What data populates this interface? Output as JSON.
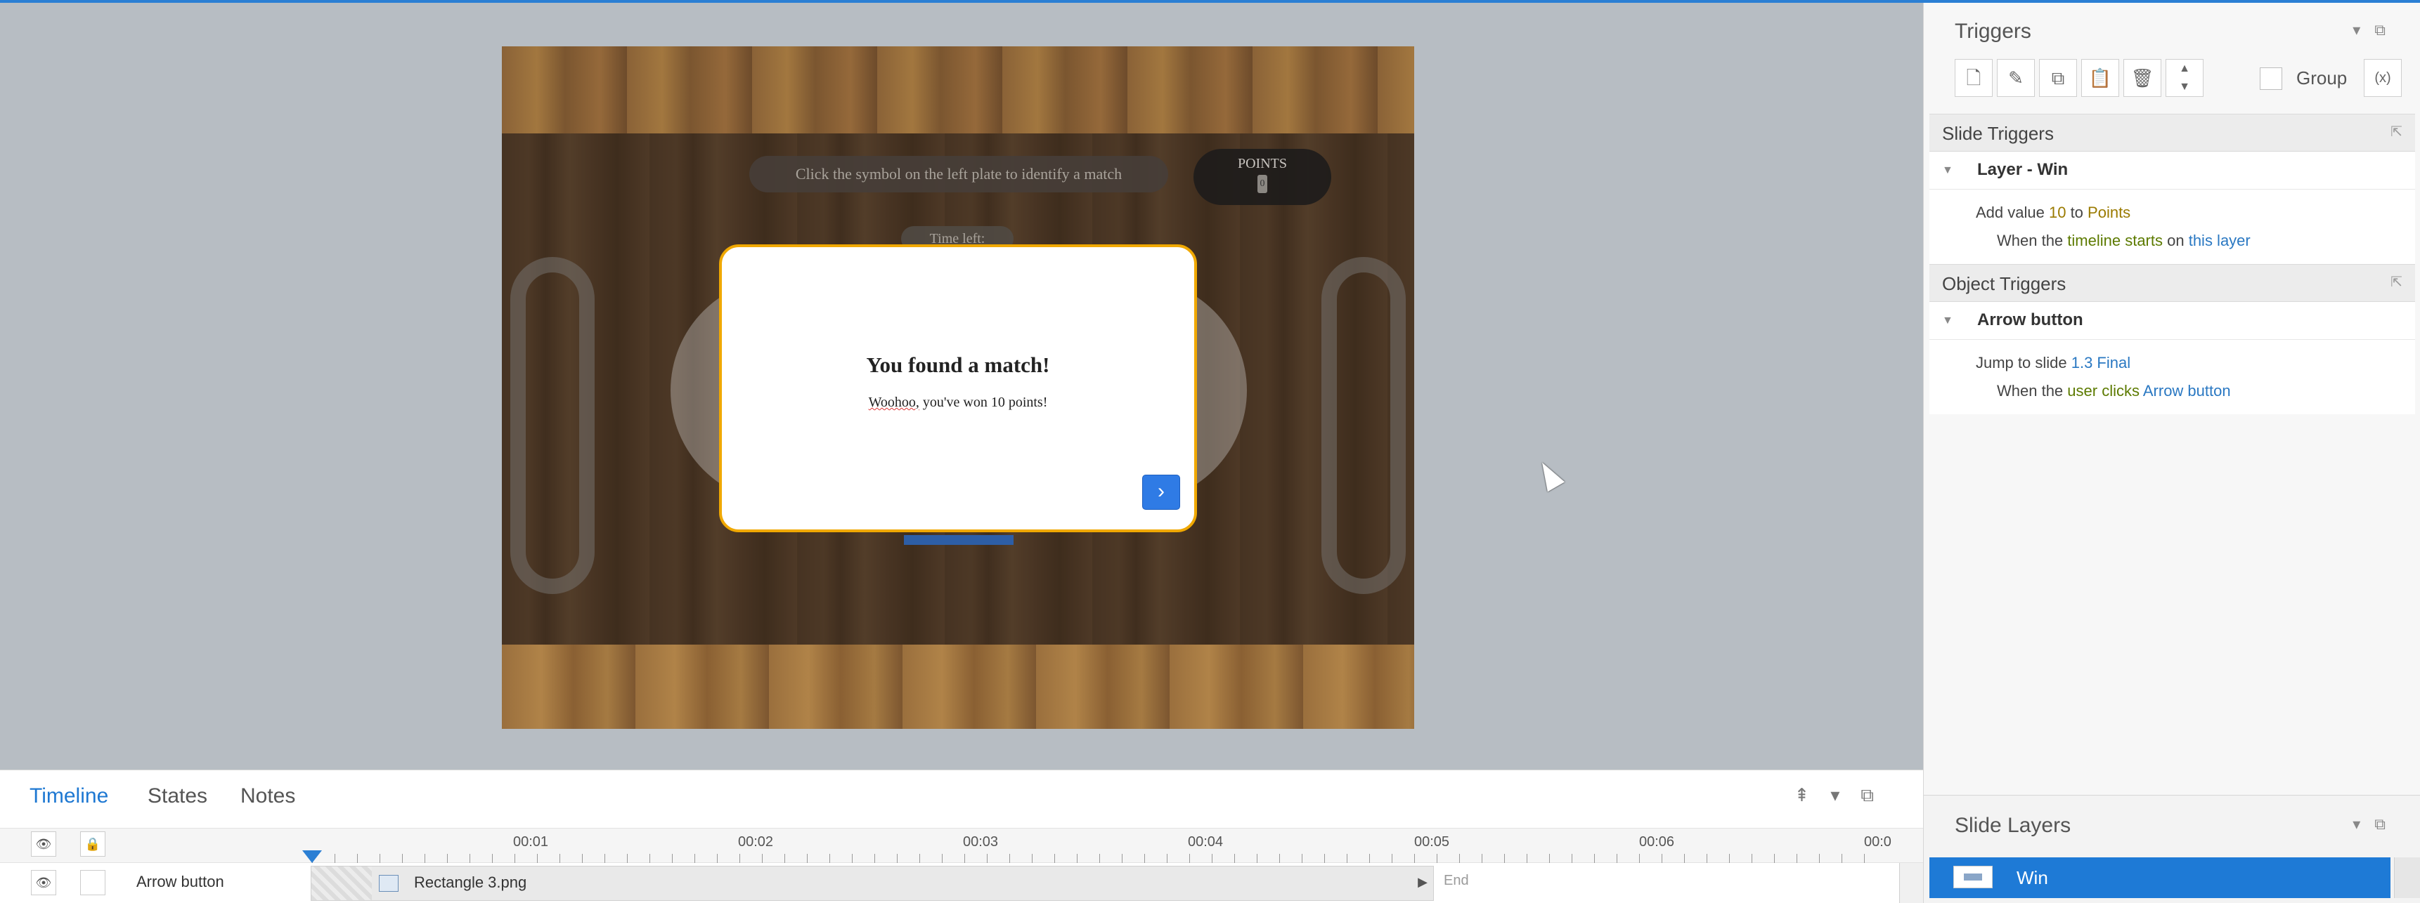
{
  "slide": {
    "instruction": "Click the symbol on the left plate to identify a match",
    "points_label": "POINTS",
    "points_value": "0",
    "time_left": "Time left:",
    "popup": {
      "title": "You found a match!",
      "body_prefix": "Woohoo,",
      "body_rest": " you've won 10 points!",
      "arrow_glyph": "›"
    }
  },
  "triggers_panel": {
    "title": "Triggers",
    "group_label": "Group",
    "slide_triggers": {
      "title": "Slide Triggers",
      "layer_name": "Layer - Win",
      "action_pre": "Add value ",
      "action_value": "10",
      "action_mid": " to ",
      "action_var": "Points",
      "cond_pre": "When the ",
      "cond_event": "timeline starts",
      "cond_mid": " on ",
      "cond_target": "this layer"
    },
    "object_triggers": {
      "title": "Object Triggers",
      "object_name": "Arrow button",
      "action_pre": "Jump to slide ",
      "action_target": "1.3 Final",
      "cond_pre": "When the ",
      "cond_event": "user clicks",
      "cond_target": "Arrow button"
    }
  },
  "slide_layers": {
    "title": "Slide Layers",
    "layers": [
      {
        "name": "Win",
        "selected": true
      }
    ]
  },
  "timeline": {
    "tabs": [
      {
        "label": "Timeline",
        "active": true
      },
      {
        "label": "States",
        "active": false
      },
      {
        "label": "Notes",
        "active": false
      }
    ],
    "ticks": [
      "00:01",
      "00:02",
      "00:03",
      "00:04",
      "00:05",
      "00:06",
      "00:0"
    ],
    "rows": [
      {
        "name": "Arrow button",
        "track_label": "Rectangle 3.png",
        "end_label": "End"
      }
    ]
  },
  "colors": {
    "accent": "#1e7ad6",
    "popup_border": "#f0a800",
    "arrow_button": "#2f7be5"
  }
}
